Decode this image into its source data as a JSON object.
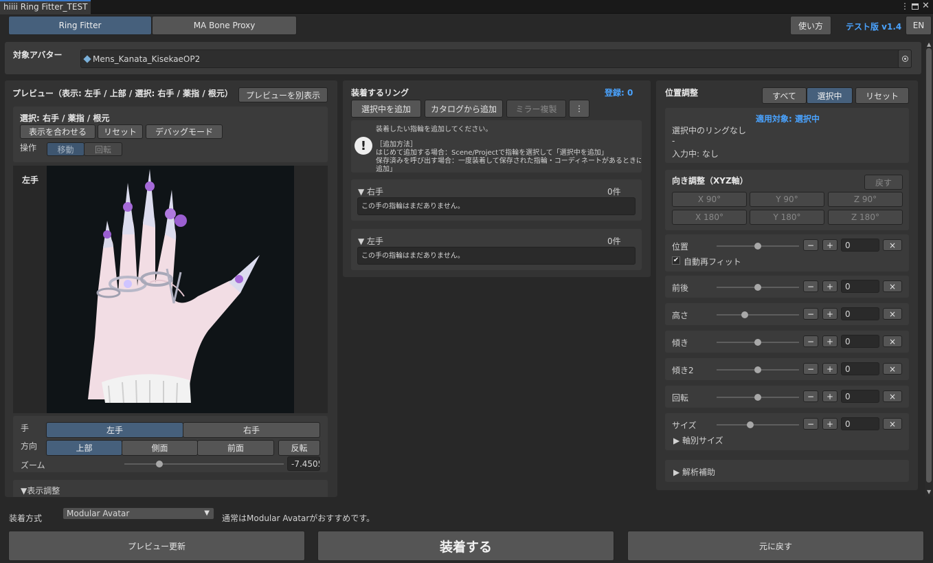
{
  "window": {
    "title": "hiiii Ring Fitter_TEST"
  },
  "tabs": [
    "Ring Fitter",
    "MA Bone Proxy"
  ],
  "header": {
    "help": "使い方",
    "version": "テスト版 v1.4",
    "lang": "EN"
  },
  "avatar": {
    "label": "対象アバター",
    "value": "Mens_Kanata_KisekaeOP2"
  },
  "preview": {
    "title": "プレビュー（表示: 左手 / 上部 / 選択: 右手 / 薬指 / 根元）",
    "popout": "プレビューを別表示",
    "selection": "選択: 右手 / 薬指 / 根元",
    "fit": "表示を合わせる",
    "reset": "リセット",
    "debug": "デバッグモード",
    "op_label": "操作",
    "move": "移動",
    "rotate": "回転",
    "hand_caption": "左手",
    "hand_label": "手",
    "left": "左手",
    "right": "右手",
    "dir_label": "方向",
    "top": "上部",
    "side": "側面",
    "front": "前面",
    "flip": "反転",
    "zoom_label": "ズーム",
    "zoom_value": "-7.4505",
    "zoom_level": 0.22,
    "display_adjust": "▼表示調整"
  },
  "rings": {
    "title": "装着するリング",
    "count": "登録: 0",
    "add_selected": "選択中を追加",
    "add_catalog": "カタログから追加",
    "mirror": "ミラー複製",
    "more": "⋮",
    "info_top": "装着したい指輪を追加してください。",
    "info_head": "［追加方法］",
    "info_1": "はじめて追加する場合：Scene/Projectで指輪を選択して「選択中を追加」",
    "info_2": "保存済みを呼び出す場合：一度装着して保存された指輪・コーディネートがあるときに「カタログから",
    "info_3": "追加」",
    "right_hand": "▼ 右手",
    "right_count": "0件",
    "right_empty": "この手の指輪はまだありません。",
    "left_hand": "▼ 左手",
    "left_count": "0件",
    "left_empty": "この手の指輪はまだありません。"
  },
  "position": {
    "title": "位置調整",
    "all": "すべて",
    "selected": "選択中",
    "reset": "リセット",
    "target": "適用対象: 選択中",
    "no_ring": "選択中のリングなし",
    "dash": "-",
    "input": "入力中: なし",
    "orient_title": "向き調整（XYZ軸）",
    "back": "戻す",
    "rot": [
      "X 90°",
      "Y 90°",
      "Z 90°",
      "X 180°",
      "Y 180°",
      "Z 180°"
    ],
    "auto_refit": "自動再フィット",
    "sliders": [
      {
        "label": "位置",
        "value": "0",
        "level": 0.5
      },
      {
        "label": "前後",
        "value": "0",
        "level": 0.5
      },
      {
        "label": "高さ",
        "value": "0",
        "level": 0.34
      },
      {
        "label": "傾き",
        "value": "0",
        "level": 0.5
      },
      {
        "label": "傾き2",
        "value": "0",
        "level": 0.5
      },
      {
        "label": "回転",
        "value": "0",
        "level": 0.5
      },
      {
        "label": "サイズ",
        "value": "0",
        "level": 0.41
      }
    ],
    "axis_size": "▶ 軸別サイズ",
    "analysis": "▶ 解析補助",
    "minus": "−",
    "plus": "+",
    "clear": "×"
  },
  "footer": {
    "method_label": "装着方式",
    "method_value": "Modular Avatar",
    "method_note": "通常はModular Avatarがおすすめです。",
    "update": "プレビュー更新",
    "apply": "装着する",
    "revert": "元に戻す"
  }
}
